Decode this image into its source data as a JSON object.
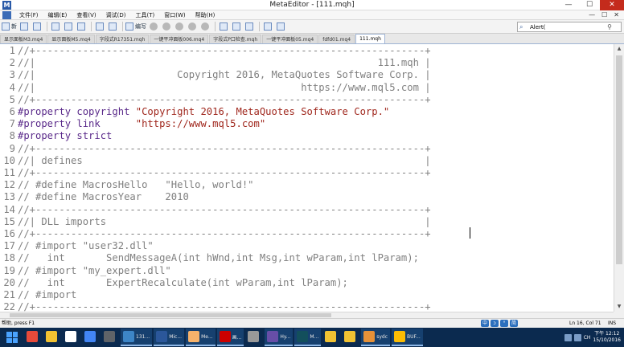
{
  "window": {
    "title": "MetaEditor - [111.mqh]",
    "app_icon": "M",
    "minimize": "—",
    "maximize": "☐",
    "close": "✕"
  },
  "menu": [
    "文件(F)",
    "编辑(E)",
    "查看(V)",
    "调试(D)",
    "工具(T)",
    "窗口(W)",
    "帮助(H)"
  ],
  "menu_right": [
    "—",
    "☐",
    "✕"
  ],
  "toolbar": {
    "new_label": "新",
    "compile_label": "编写",
    "search_value": "Alert("
  },
  "tabs": [
    {
      "label": "显示面板M3.mq4"
    },
    {
      "label": "显示面板M5.mq4"
    },
    {
      "label": "字段式R17351.mqh"
    },
    {
      "label": "一键平冲面板006.mq4"
    },
    {
      "label": "字段式P口检查.mqh"
    },
    {
      "label": "一键平冲面板05.mq4"
    },
    {
      "label": "fdfd01.mq4"
    },
    {
      "label": "111.mqh",
      "active": true
    }
  ],
  "code_lines": [
    {
      "n": "1",
      "text": "//+------------------------------------------------------------------+",
      "kind": "comment"
    },
    {
      "n": "2",
      "text": "//|                                                          111.mqh |",
      "kind": "comment"
    },
    {
      "n": "3",
      "text": "//|                        Copyright 2016, MetaQuotes Software Corp. |",
      "kind": "comment"
    },
    {
      "n": "4",
      "text": "//|                                             https://www.mql5.com |",
      "kind": "comment"
    },
    {
      "n": "5",
      "text": "//+------------------------------------------------------------------+",
      "kind": "comment"
    },
    {
      "n": "6",
      "text": "#property copyright ",
      "str": "\"Copyright 2016, MetaQuotes Software Corp.\"",
      "kind": "pp"
    },
    {
      "n": "7",
      "text": "#property link      ",
      "str": "\"https://www.mql5.com\"",
      "kind": "pp"
    },
    {
      "n": "8",
      "text": "#property strict",
      "kind": "pp"
    },
    {
      "n": "9",
      "text": "//+------------------------------------------------------------------+",
      "kind": "comment"
    },
    {
      "n": "10",
      "text": "//| defines                                                          |",
      "kind": "comment"
    },
    {
      "n": "11",
      "text": "//+------------------------------------------------------------------+",
      "kind": "comment"
    },
    {
      "n": "12",
      "text": "// #define MacrosHello   \"Hello, world!\"",
      "kind": "comment"
    },
    {
      "n": "13",
      "text": "// #define MacrosYear    2010",
      "kind": "comment"
    },
    {
      "n": "14",
      "text": "//+------------------------------------------------------------------+",
      "kind": "comment"
    },
    {
      "n": "15",
      "text": "//| DLL imports                                                      |",
      "kind": "comment"
    },
    {
      "n": "16",
      "text": "//+------------------------------------------------------------------+",
      "kind": "comment"
    },
    {
      "n": "17",
      "text": "// #import \"user32.dll\"",
      "kind": "comment"
    },
    {
      "n": "18",
      "text": "//   int       SendMessageA(int hWnd,int Msg,int wParam,int lParam);",
      "kind": "comment"
    },
    {
      "n": "19",
      "text": "// #import \"my_expert.dll\"",
      "kind": "comment"
    },
    {
      "n": "20",
      "text": "//   int       ExpertRecalculate(int wParam,int lParam);",
      "kind": "comment"
    },
    {
      "n": "21",
      "text": "// #import",
      "kind": "comment"
    },
    {
      "n": "22",
      "text": "//+------------------------------------------------------------------+",
      "kind": "comment"
    }
  ],
  "status": {
    "help": "帮助, press F1",
    "position": "Ln 16, Col 71",
    "mode": "INS",
    "ime": [
      "中",
      "ᴐ",
      "°",
      "简"
    ]
  },
  "taskbar": {
    "apps": [
      {
        "label": "",
        "color": "#e84a3a",
        "open": false
      },
      {
        "label": "",
        "color": "#f1c232",
        "open": false
      },
      {
        "label": "",
        "color": "#ffffff",
        "open": false
      },
      {
        "label": "",
        "color": "#4285f4",
        "open": false
      },
      {
        "label": "",
        "color": "#5f6368",
        "open": false
      },
      {
        "label": "131...",
        "color": "#3d85c6",
        "open": true
      },
      {
        "label": "Mic...",
        "color": "#2b579a",
        "open": true
      },
      {
        "label": "Me...",
        "color": "#f6b26b",
        "open": true
      },
      {
        "label": "画...",
        "color": "#cc0000",
        "open": true
      },
      {
        "label": "",
        "color": "#999999",
        "open": false
      },
      {
        "label": "Hy...",
        "color": "#674ea7",
        "open": true
      },
      {
        "label": "M...",
        "color": "#134f5c",
        "open": true
      },
      {
        "label": "",
        "color": "#f1c232",
        "open": false
      },
      {
        "label": "",
        "color": "#f1c232",
        "open": false
      },
      {
        "label": "sydc",
        "color": "#e69138",
        "open": true
      },
      {
        "label": "BUF...",
        "color": "#fbbc04",
        "open": true
      }
    ],
    "tray_label": "CH",
    "time": "下午 12:12",
    "date": "15/10/2016"
  }
}
